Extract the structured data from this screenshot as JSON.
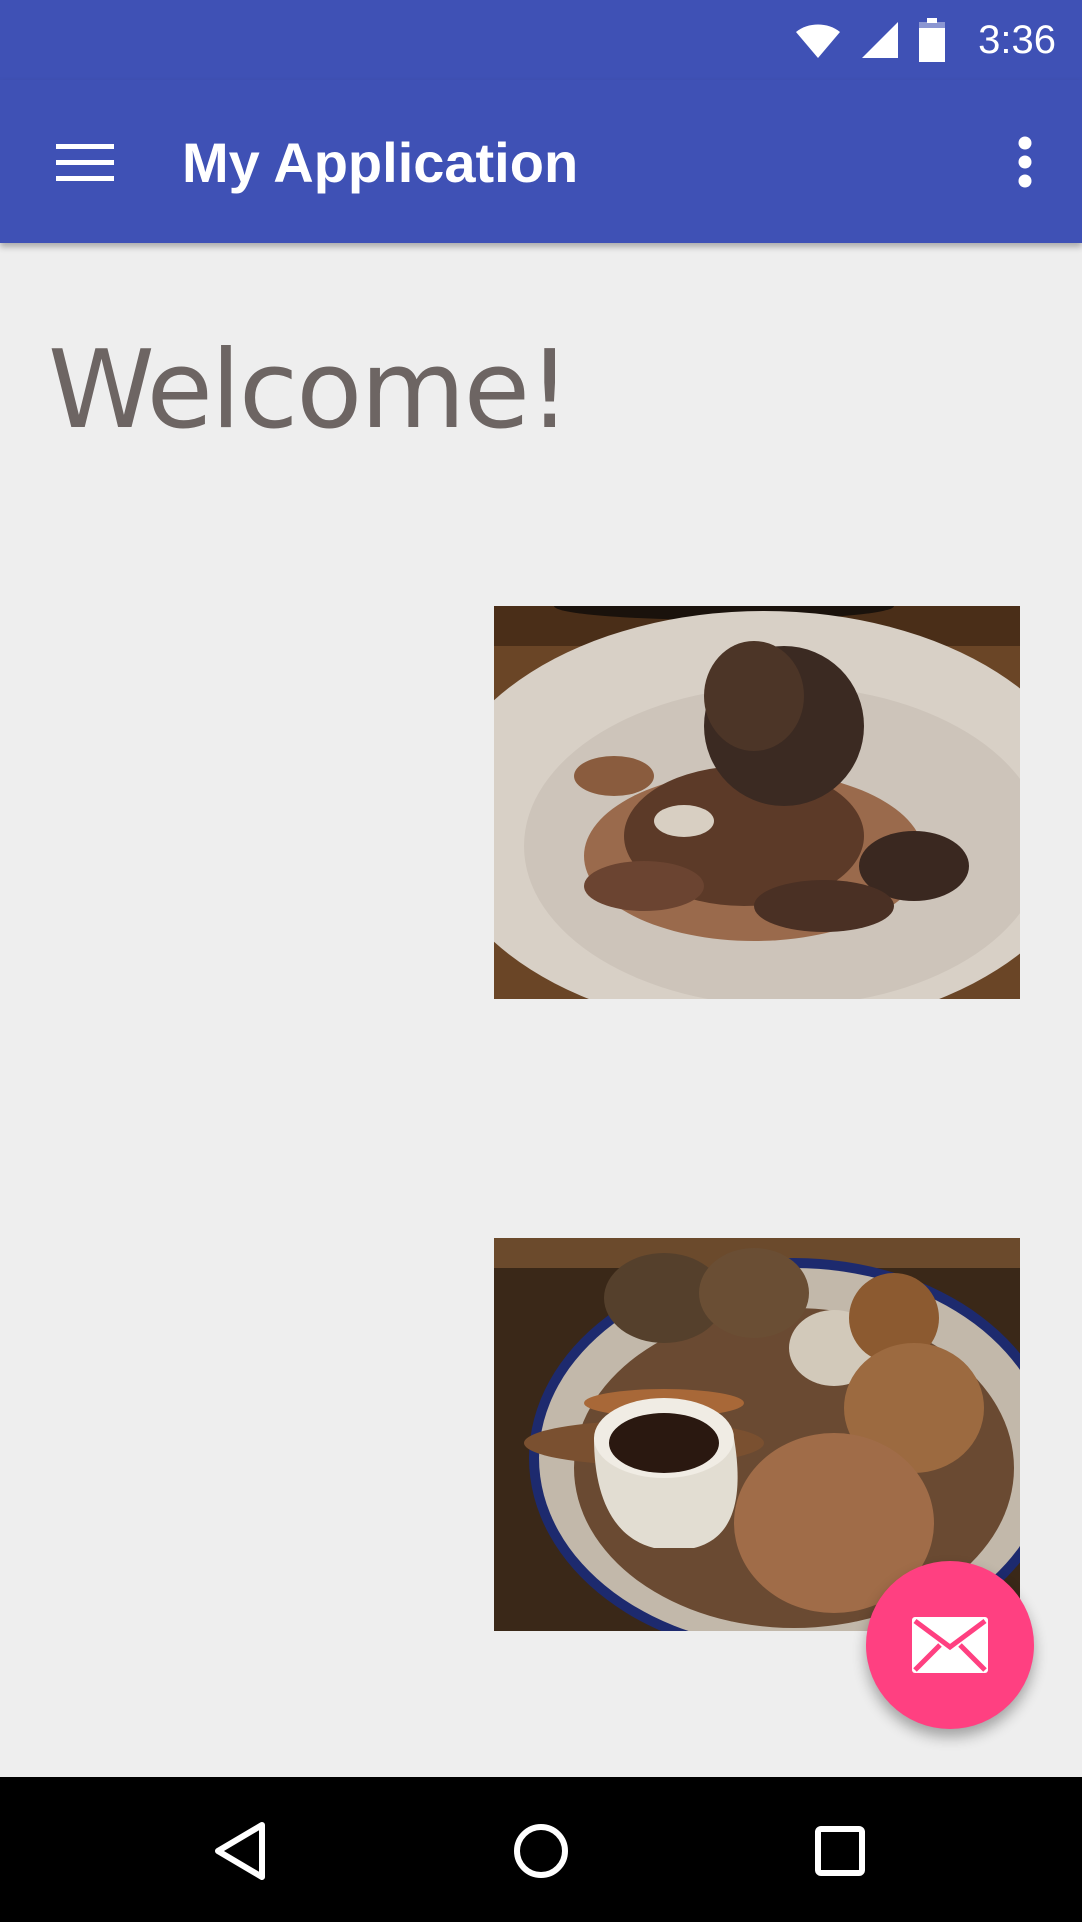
{
  "status_bar": {
    "time": "3:36",
    "icons": [
      "wifi-icon",
      "cell-signal-icon",
      "battery-icon"
    ],
    "color": "#3f51b5"
  },
  "app_bar": {
    "title": "My Application",
    "menu_icon": "hamburger-menu-icon",
    "overflow_icon": "more-vert-icon",
    "color": "#3f51b5"
  },
  "main": {
    "heading": "Welcome!",
    "images": [
      {
        "name": "mushroom-dish-photo"
      },
      {
        "name": "roast-dinner-photo"
      }
    ]
  },
  "fab": {
    "icon": "mail-icon",
    "color": "#ff4081"
  },
  "nav_bar": {
    "buttons": [
      "back-icon",
      "home-icon",
      "recent-apps-icon"
    ]
  }
}
